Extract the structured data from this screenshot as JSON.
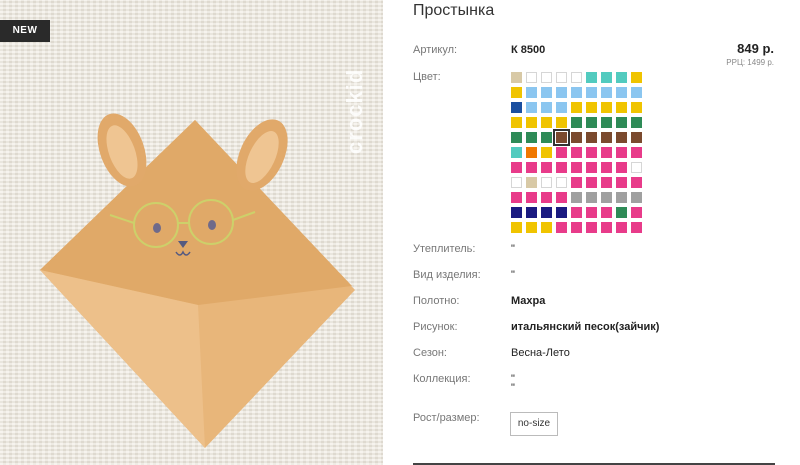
{
  "product": {
    "badge": "NEW",
    "brand": "crockid",
    "title": "Простынка",
    "article_label": "Артикул:",
    "article_value": "К 8500",
    "price": "849 р.",
    "rrp": "РРЦ: 1499 р.",
    "color_label": "Цвет:",
    "swatches": [
      [
        "#d8c9a6",
        "empty",
        "empty",
        "empty",
        "empty",
        "#52cbbf",
        "#52cbbf",
        "#52cbbf",
        "#f0c400"
      ],
      [
        "#f0c400",
        "#8bc6f0",
        "#8bc6f0",
        "#8bc6f0",
        "#8bc6f0",
        "#8bc6f0",
        "#8bc6f0",
        "#8bc6f0",
        "#8bc6f0"
      ],
      [
        "#1a4fa0",
        "#8bc6f0",
        "#8bc6f0",
        "#8bc6f0",
        "#f0c400",
        "#f0c400",
        "#f0c400",
        "#f0c400",
        "#f0c400"
      ],
      [
        "#f0c400",
        "#f0c400",
        "#f0c400",
        "#f0c400",
        "#2e8b57",
        "#2e8b57",
        "#2e8b57",
        "#2e8b57",
        "#2e8b57"
      ],
      [
        "#2e8b57",
        "#2e8b57",
        "#2e8b57",
        "#7b4a2e",
        "#7b4a2e",
        "#7b4a2e",
        "#7b4a2e",
        "#7b4a2e",
        "#7b4a2e"
      ],
      [
        "#52cbbf",
        "#f07800",
        "#f0c400",
        "#e83b8a",
        "#e83b8a",
        "#e83b8a",
        "#e83b8a",
        "#e83b8a",
        "#e83b8a"
      ],
      [
        "#e83b8a",
        "#e83b8a",
        "#e83b8a",
        "#e83b8a",
        "#e83b8a",
        "#e83b8a",
        "#e83b8a",
        "#e83b8a",
        "empty"
      ],
      [
        "empty",
        "#d8c9a6",
        "empty",
        "empty",
        "#e83b8a",
        "#e83b8a",
        "#e83b8a",
        "#e83b8a",
        "#e83b8a"
      ],
      [
        "#e83b8a",
        "#e83b8a",
        "#e83b8a",
        "#e83b8a",
        "#a0a0a0",
        "#a0a0a0",
        "#a0a0a0",
        "#a0a0a0",
        "#a0a0a0"
      ],
      [
        "#1a1a80",
        "#1a1a80",
        "#1a1a80",
        "#1a1a80",
        "#e83b8a",
        "#e83b8a",
        "#e83b8a",
        "#2e8b57",
        "#e83b8a"
      ],
      [
        "#f0c400",
        "#f0c400",
        "#f0c400",
        "#e83b8a",
        "#e83b8a",
        "#e83b8a",
        "#e83b8a",
        "#e83b8a",
        "#e83b8a"
      ]
    ],
    "selected_swatch": "4-3",
    "props": [
      {
        "label": "Утеплитель:",
        "value": "\""
      },
      {
        "label": "Вид изделия:",
        "value": "\""
      },
      {
        "label": "Полотно:",
        "value": "Махра"
      },
      {
        "label": "Рисунок:",
        "value": "итальянский песок(зайчик)"
      },
      {
        "label": "Сезон:",
        "value": "Весна-Лето"
      },
      {
        "label": "Коллекция:",
        "value": "\"",
        "value2": "\""
      }
    ],
    "size_label": "Рост/размер:",
    "size_option": "no-size"
  }
}
